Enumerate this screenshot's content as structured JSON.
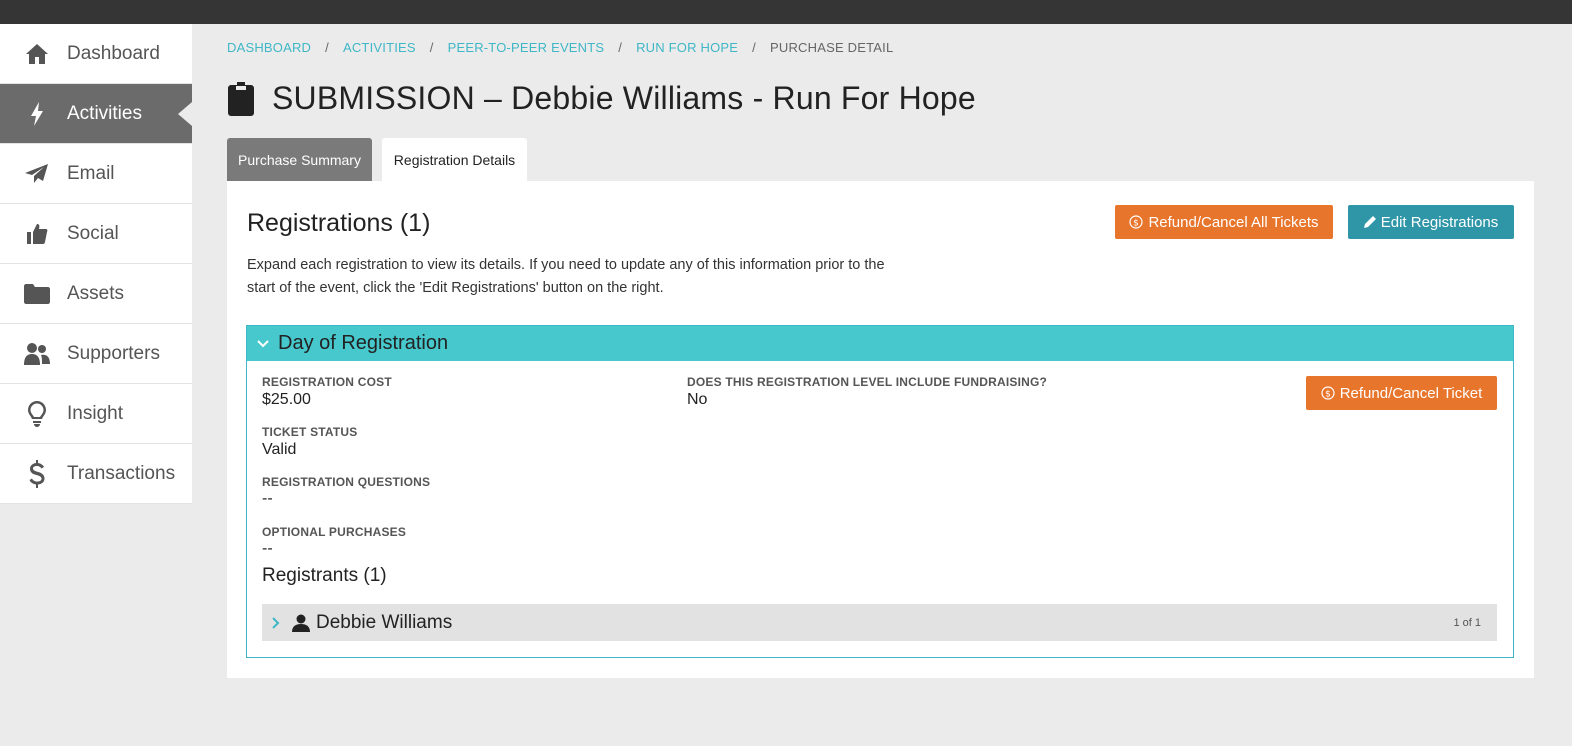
{
  "sidebar": {
    "items": [
      {
        "label": "Dashboard",
        "icon": "home-icon"
      },
      {
        "label": "Activities",
        "icon": "bolt-icon",
        "active": true
      },
      {
        "label": "Email",
        "icon": "paper-plane-icon"
      },
      {
        "label": "Social",
        "icon": "thumbs-up-icon"
      },
      {
        "label": "Assets",
        "icon": "folder-icon"
      },
      {
        "label": "Supporters",
        "icon": "users-icon"
      },
      {
        "label": "Insight",
        "icon": "lightbulb-icon"
      },
      {
        "label": "Transactions",
        "icon": "dollar-icon"
      }
    ]
  },
  "breadcrumb": {
    "items": [
      "DASHBOARD",
      "ACTIVITIES",
      "PEER-TO-PEER EVENTS",
      "RUN FOR HOPE"
    ],
    "current": "PURCHASE DETAIL",
    "separator": "/"
  },
  "page": {
    "title": "SUBMISSION – Debbie Williams - Run For Hope",
    "title_icon": "clipboard-icon"
  },
  "tabs": [
    {
      "label": "Purchase Summary",
      "active": false
    },
    {
      "label": "Registration Details",
      "active": true
    }
  ],
  "registrations": {
    "heading": "Registrations (1)",
    "description": "Expand each registration to view its details. If you need to update any of this information prior to the start of the event, click the 'Edit Registrations' button on the right.",
    "refund_all_label": "Refund/Cancel All Tickets",
    "edit_label": "Edit Registrations"
  },
  "registration_item": {
    "title": "Day of Registration",
    "cost_label": "REGISTRATION COST",
    "cost_value": "$25.00",
    "fundraising_label": "DOES THIS REGISTRATION LEVEL INCLUDE FUNDRAISING?",
    "fundraising_value": "No",
    "ticket_status_label": "TICKET STATUS",
    "ticket_status_value": "Valid",
    "questions_label": "REGISTRATION QUESTIONS",
    "questions_value": "--",
    "optional_label": "OPTIONAL PURCHASES",
    "optional_value": "--",
    "refund_label": "Refund/Cancel Ticket",
    "registrants_heading": "Registrants (1)",
    "registrants": [
      {
        "name": "Debbie Williams",
        "count": "1 of 1"
      }
    ]
  },
  "colors": {
    "accent_teal": "#46c8cd",
    "link_teal": "#3fb7c6",
    "button_teal": "#2f96a8",
    "button_orange": "#e8752c",
    "sidebar_active": "#6b6b6b"
  }
}
